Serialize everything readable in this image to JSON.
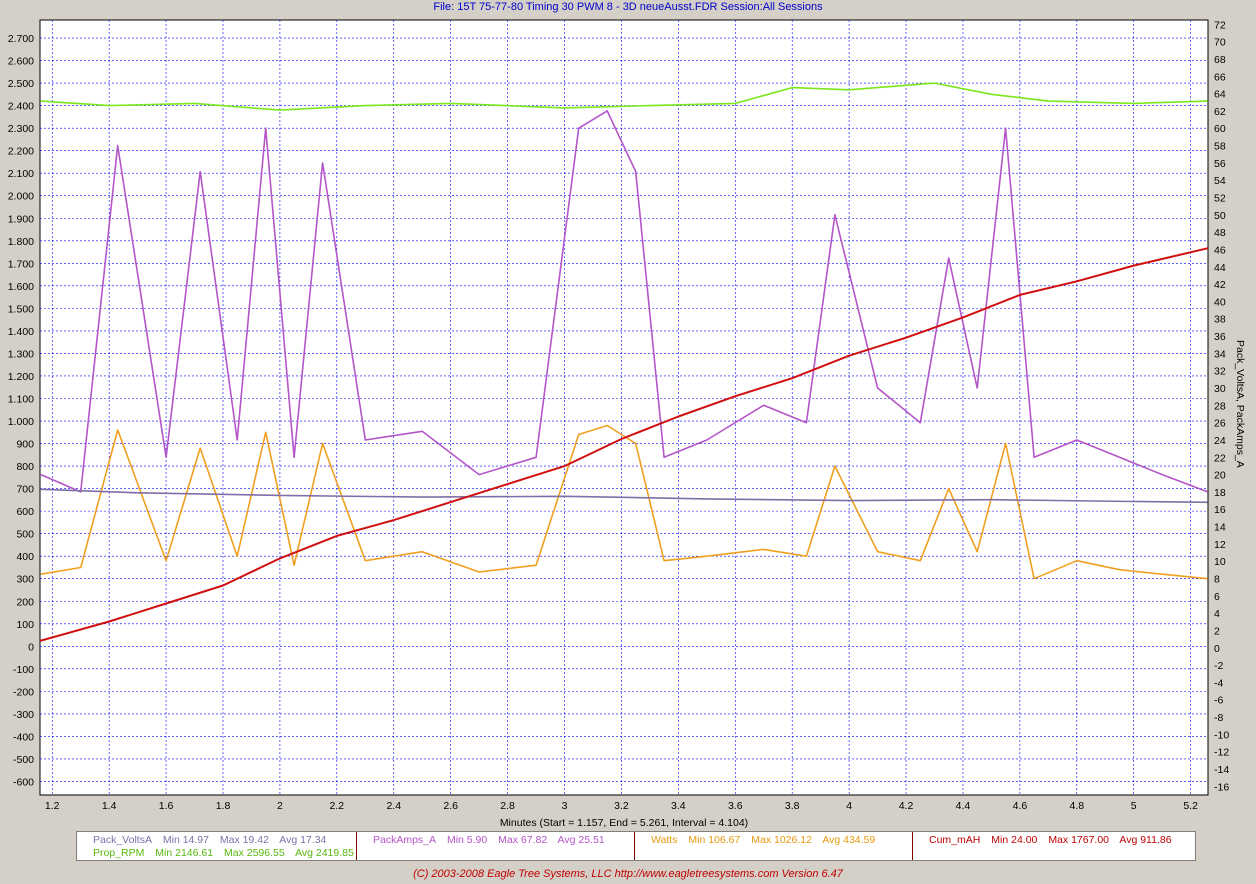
{
  "title": "File: 15T 75-77-80 Timing 30 PWM 8 - 3D neueAusst.FDR   Session:All Sessions",
  "footer": "(C) 2003-2008 Eagle Tree Systems, LLC     http://www.eagletreesystems.com     Version 6.47",
  "colors": {
    "background": "#d4d0c8",
    "plot_bg": "#ffffff",
    "grid": "#0000ff",
    "pack_volts": "#7f6fa8",
    "pack_amps": "#b455c8",
    "watts": "#f0a020",
    "cum_mah": "#d01010",
    "prop_rpm": "#7ae81a"
  },
  "legend": {
    "pack_volts": {
      "name": "Pack_VoltsA",
      "min": "Min 14.97",
      "max": "Max 19.42",
      "avg": "Avg 17.34"
    },
    "prop_rpm": {
      "name": "Prop_RPM",
      "min": "Min 2146.61",
      "max": "Max 2596.55",
      "avg": "Avg 2419.85"
    },
    "pack_amps": {
      "name": "PackAmps_A",
      "min": "Min 5.90",
      "max": "Max 67.82",
      "avg": "Avg 25.51"
    },
    "watts": {
      "name": "Watts",
      "min": "Min 106.67",
      "max": "Max 1026.12",
      "avg": "Avg 434.59"
    },
    "cum_mah": {
      "name": "Cum_mAH",
      "min": "Min 24.00",
      "max": "Max 1767.00",
      "avg": "Avg 911.86"
    }
  },
  "chart_data": {
    "type": "line",
    "xlabel": "Minutes (Start = 1.157,  End = 5.261,  Interval =  4.104)",
    "ylabel_right": "Pack_VoltsA, PackAmps_A",
    "xlim": [
      1.157,
      5.261
    ],
    "ylim_left": [
      -660,
      2780
    ],
    "ylim_right": [
      -17.0,
      72.5
    ],
    "x_ticks": [
      "1.2",
      "1.4",
      "1.6",
      "1.8",
      "2",
      "2.2",
      "2.4",
      "2.6",
      "2.8",
      "3",
      "3.2",
      "3.4",
      "3.6",
      "3.8",
      "4",
      "4.2",
      "4.4",
      "4.6",
      "4.8",
      "5",
      "5.2"
    ],
    "y_left_ticks": [
      "2.700",
      "2.600",
      "2.500",
      "2.400",
      "2.300",
      "2.200",
      "2.100",
      "2.000",
      "1.900",
      "1.800",
      "1.700",
      "1.600",
      "1.500",
      "1.400",
      "1.300",
      "1.200",
      "1.100",
      "1.000",
      "900",
      "800",
      "700",
      "600",
      "500",
      "400",
      "300",
      "200",
      "100",
      "0",
      "-100",
      "-200",
      "-300",
      "-400",
      "-500",
      "-600"
    ],
    "y_right_ticks": [
      "72",
      "70",
      "68",
      "66",
      "64",
      "62",
      "60",
      "58",
      "56",
      "54",
      "52",
      "50",
      "48",
      "46",
      "44",
      "42",
      "40",
      "38",
      "36",
      "34",
      "32",
      "30",
      "28",
      "26",
      "24",
      "22",
      "20",
      "18",
      "16",
      "14",
      "12",
      "10",
      "8",
      "6",
      "4",
      "2",
      "0",
      "-2",
      "-4",
      "-6",
      "-8",
      "-10",
      "-12",
      "-14",
      "-16"
    ],
    "series": [
      {
        "name": "Pack_VoltsA",
        "axis": "right",
        "x": [
          1.16,
          1.5,
          2.0,
          2.5,
          3.0,
          3.5,
          4.0,
          4.5,
          5.0,
          5.26
        ],
        "y": [
          18.3,
          17.9,
          17.6,
          17.4,
          17.5,
          17.2,
          17.0,
          17.1,
          16.9,
          16.8
        ]
      },
      {
        "name": "Prop_RPM",
        "axis": "left",
        "x": [
          1.16,
          1.4,
          1.7,
          2.0,
          2.3,
          2.6,
          3.0,
          3.3,
          3.6,
          3.8,
          4.0,
          4.3,
          4.5,
          4.7,
          5.0,
          5.26
        ],
        "y": [
          2420,
          2400,
          2410,
          2380,
          2400,
          2410,
          2390,
          2400,
          2410,
          2480,
          2470,
          2500,
          2450,
          2420,
          2410,
          2420
        ]
      },
      {
        "name": "PackAmps_A",
        "axis": "right",
        "x": [
          1.16,
          1.3,
          1.43,
          1.6,
          1.72,
          1.85,
          1.95,
          2.05,
          2.15,
          2.3,
          2.5,
          2.7,
          2.9,
          3.05,
          3.15,
          3.25,
          3.35,
          3.5,
          3.7,
          3.85,
          3.95,
          4.1,
          4.25,
          4.35,
          4.45,
          4.55,
          4.65,
          4.8,
          4.95,
          5.1,
          5.26
        ],
        "y": [
          20,
          18,
          58,
          22,
          55,
          24,
          60,
          22,
          56,
          24,
          25,
          20,
          22,
          60,
          62,
          55,
          22,
          24,
          28,
          26,
          50,
          30,
          26,
          45,
          30,
          60,
          22,
          24,
          22,
          20,
          18
        ]
      },
      {
        "name": "Watts",
        "axis": "left",
        "x": [
          1.16,
          1.3,
          1.43,
          1.6,
          1.72,
          1.85,
          1.95,
          2.05,
          2.15,
          2.3,
          2.5,
          2.7,
          2.9,
          3.05,
          3.15,
          3.25,
          3.35,
          3.5,
          3.7,
          3.85,
          3.95,
          4.1,
          4.25,
          4.35,
          4.45,
          4.55,
          4.65,
          4.8,
          4.95,
          5.1,
          5.26
        ],
        "y": [
          320,
          350,
          960,
          380,
          880,
          400,
          950,
          360,
          900,
          380,
          420,
          330,
          360,
          940,
          980,
          900,
          380,
          400,
          430,
          400,
          800,
          420,
          380,
          700,
          420,
          900,
          300,
          380,
          340,
          320,
          300
        ]
      },
      {
        "name": "Cum_mAH",
        "axis": "left",
        "x": [
          1.157,
          1.4,
          1.6,
          1.8,
          2.0,
          2.2,
          2.4,
          2.6,
          2.8,
          3.0,
          3.2,
          3.4,
          3.6,
          3.8,
          4.0,
          4.2,
          4.4,
          4.6,
          4.8,
          5.0,
          5.261
        ],
        "y": [
          24,
          110,
          190,
          270,
          390,
          490,
          560,
          640,
          720,
          800,
          920,
          1020,
          1110,
          1190,
          1290,
          1370,
          1460,
          1560,
          1620,
          1690,
          1767
        ]
      }
    ]
  }
}
